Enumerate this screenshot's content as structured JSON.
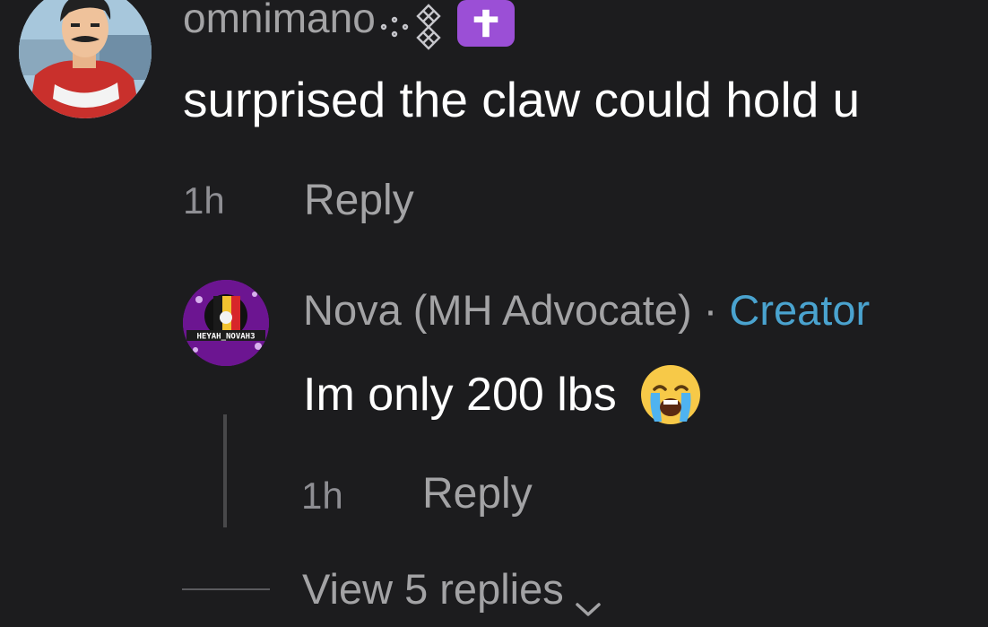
{
  "colors": {
    "background": "#1c1c1e",
    "primary_text": "#ffffff",
    "secondary_text": "#a3a3a5",
    "timestamp": "#8e8e93",
    "creator_accent": "#4aa3cf",
    "cross_badge": "#9b4fd6"
  },
  "comment": {
    "username": "omnimano",
    "username_icons": [
      "ornament-icon",
      "latin-cross-icon"
    ],
    "text": "surprised the claw could hold u",
    "time": "1h",
    "reply_label": "Reply"
  },
  "reply": {
    "username": "Nova (MH Advocate)",
    "separator": "·",
    "badge": "Creator",
    "avatar_caption": "HEYAH_NOVAH3",
    "text": "Im only 200 lbs",
    "emoji": "loudly-crying-face-icon",
    "time": "1h",
    "reply_label": "Reply"
  },
  "view_replies": {
    "label": "View 5 replies",
    "icon": "chevron-down-icon"
  }
}
